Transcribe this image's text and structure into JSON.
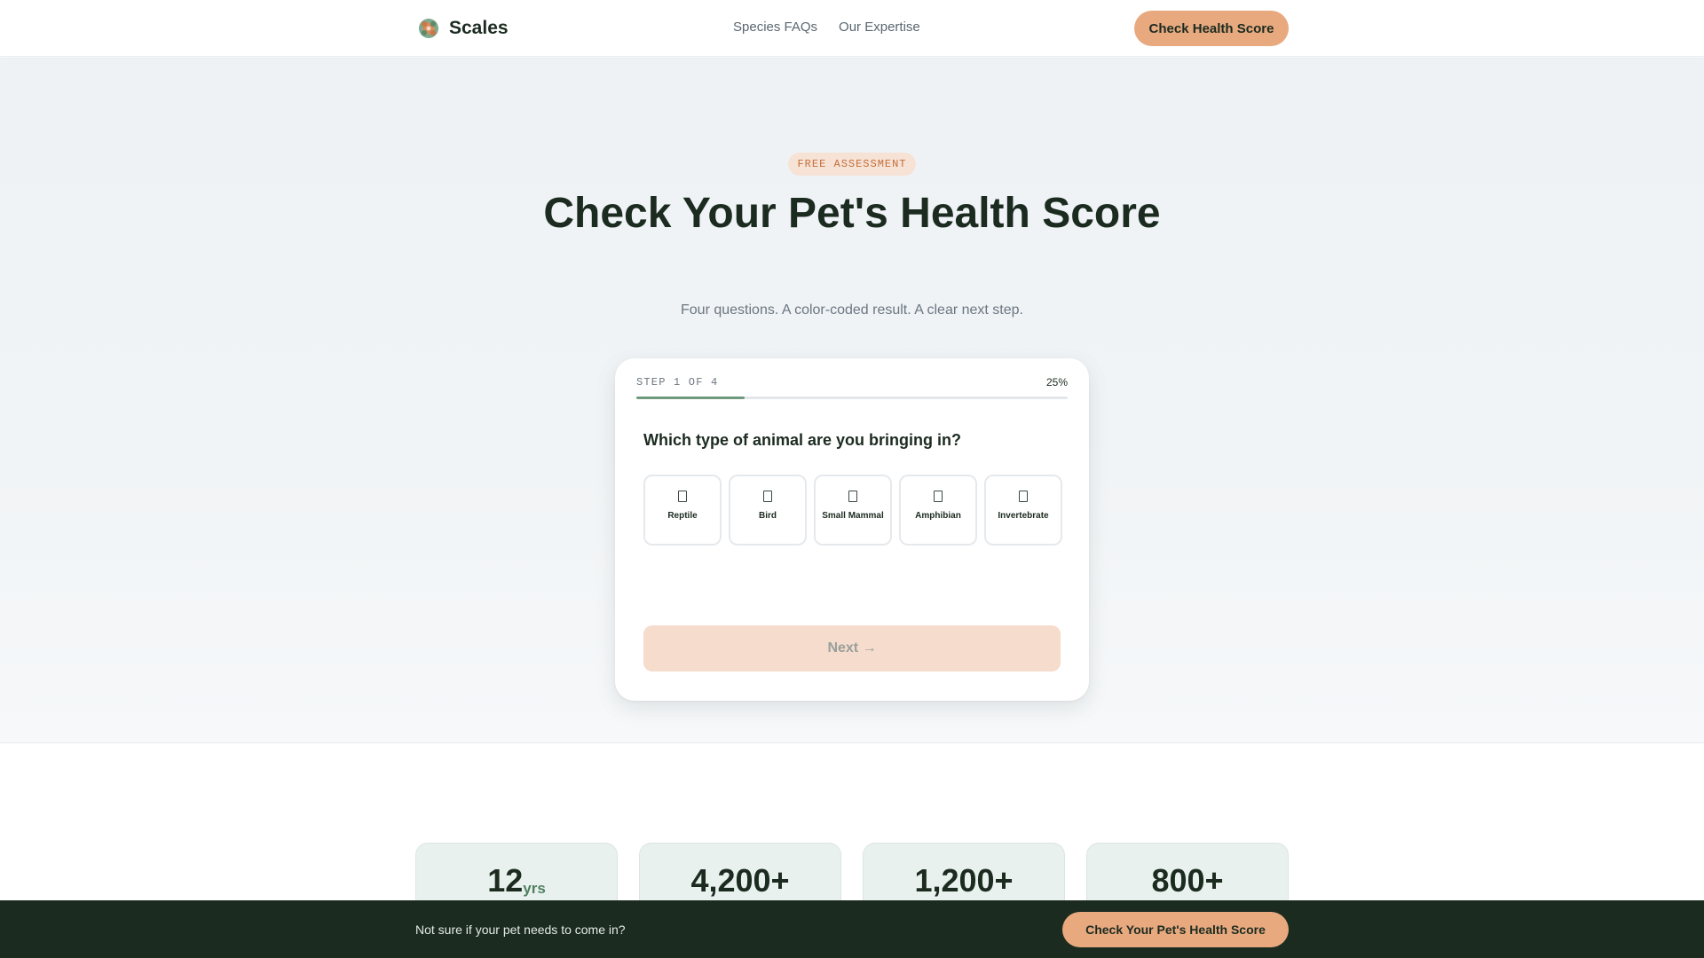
{
  "brand": {
    "name": "Scales",
    "logo_icon": "tortoise-logo-icon"
  },
  "nav": {
    "items": [
      "Species FAQs",
      "Our Expertise"
    ]
  },
  "header": {
    "cta_label": "Check Health Score"
  },
  "hero": {
    "badge": "FREE ASSESSMENT",
    "title": "Check Your Pet's Health Score",
    "subtitle": "Four questions. A color-coded result. A clear next step."
  },
  "quiz": {
    "step_label": "STEP 1 OF 4",
    "percent_label": "25%",
    "progress": 0.25,
    "question": "Which type of animal are you bringing in?",
    "options": [
      {
        "label": "Reptile",
        "icon": "reptile-icon"
      },
      {
        "label": "Bird",
        "icon": "bird-icon"
      },
      {
        "label": "Small Mammal",
        "icon": "small-mammal-icon"
      },
      {
        "label": "Amphibian",
        "icon": "amphibian-icon"
      },
      {
        "label": "Invertebrate",
        "icon": "invertebrate-icon"
      }
    ],
    "next_label": "Next →",
    "next_disabled": true
  },
  "stats": [
    {
      "value": "12",
      "unit": "yrs"
    },
    {
      "value": "4,200+",
      "unit": ""
    },
    {
      "value": "1,200+",
      "unit": ""
    },
    {
      "value": "800+",
      "unit": ""
    }
  ],
  "bottom_bar": {
    "text": "Not sure if your pet needs to come in?",
    "cta_label": "Check Your Pet's Health Score"
  },
  "colors": {
    "accent": "#e8a97f",
    "dark": "#1b2b1f",
    "progress": "#6e9a7e"
  }
}
